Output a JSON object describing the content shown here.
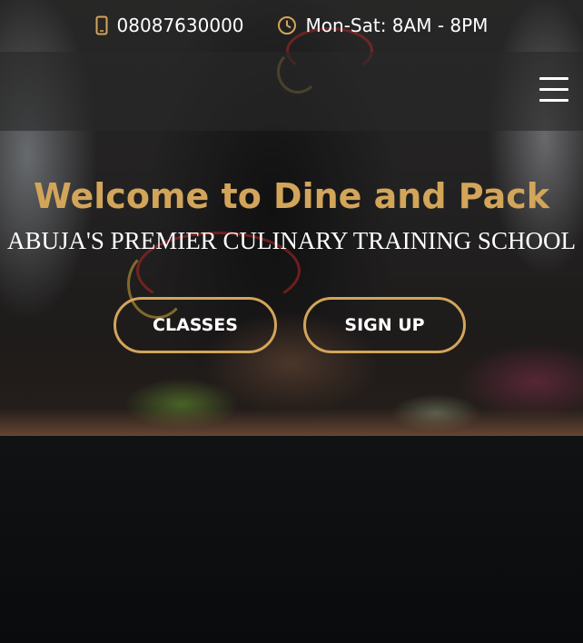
{
  "topbar": {
    "phone": "08087630000",
    "hours": "Mon-Sat: 8AM - 8PM",
    "phone_icon": "phone-icon",
    "clock_icon": "clock-icon"
  },
  "nav": {
    "menu_icon": "hamburger-menu-icon"
  },
  "hero": {
    "title": "Welcome to Dine and Pack",
    "subtitle": "ABUJA'S PREMIER CULINARY TRAINING SCHOOL",
    "buttons": [
      {
        "label": "CLASSES"
      },
      {
        "label": "SIGN UP"
      }
    ]
  },
  "colors": {
    "accent_gold": "#d2a55a",
    "text_white": "#ffffff",
    "navbar_overlay": "rgba(40,40,40,0.62)",
    "lower_background": "#0b0c0e"
  }
}
